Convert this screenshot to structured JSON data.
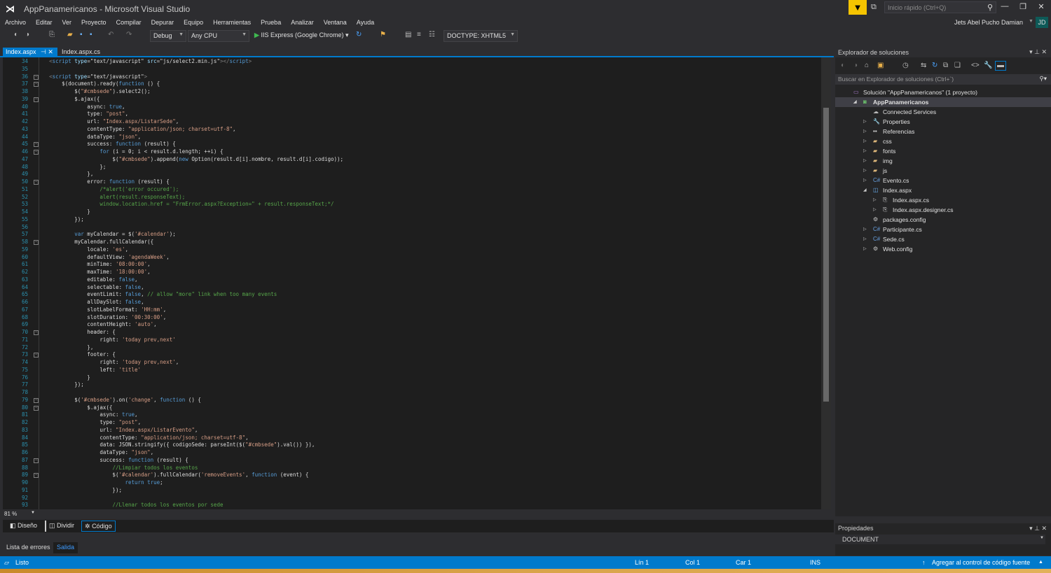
{
  "window": {
    "title": "AppPanamericanos - Microsoft Visual Studio",
    "quick_launch_placeholder": "Inicio rápido (Ctrl+Q)",
    "user": "Jets Abel Pucho Damian",
    "avatar_initials": "JD"
  },
  "menu": [
    "Archivo",
    "Editar",
    "Ver",
    "Proyecto",
    "Compilar",
    "Depurar",
    "Equipo",
    "Herramientas",
    "Prueba",
    "Analizar",
    "Ventana",
    "Ayuda"
  ],
  "toolbar": {
    "config": "Debug",
    "platform": "Any CPU",
    "run_target": "IIS Express (Google Chrome)",
    "doctype": "DOCTYPE: XHTML5"
  },
  "tabs": [
    {
      "label": "Index.aspx",
      "active": true
    },
    {
      "label": "Index.aspx.cs",
      "active": false
    }
  ],
  "editor": {
    "zoom": "81 %",
    "fold_lines": [
      36,
      37,
      39,
      45,
      46,
      50,
      58,
      70,
      73,
      79,
      80,
      87,
      89
    ],
    "lines": [
      {
        "n": 34,
        "code": [
          [
            "t",
            "        "
          ],
          [
            "g",
            "<"
          ],
          [
            "k",
            "script"
          ],
          [
            "a",
            " type"
          ],
          [
            "t",
            "=\"text/javascript\""
          ],
          [
            "a",
            " src"
          ],
          [
            "t",
            "=\"js/select2.min.js\""
          ],
          [
            "g",
            "></"
          ],
          [
            "k",
            "script"
          ],
          [
            "g",
            ">"
          ]
        ]
      },
      {
        "n": 35,
        "code": []
      },
      {
        "n": 36,
        "code": [
          [
            "t",
            "        "
          ],
          [
            "g",
            "<"
          ],
          [
            "k",
            "script"
          ],
          [
            "a",
            " type"
          ],
          [
            "t",
            "=\"text/javascript\""
          ],
          [
            "g",
            ">"
          ]
        ]
      },
      {
        "n": 37,
        "code": [
          [
            "t",
            "            $(document).ready("
          ],
          [
            "k",
            "function"
          ],
          [
            "t",
            " () {"
          ]
        ]
      },
      {
        "n": 38,
        "code": [
          [
            "t",
            "                $("
          ],
          [
            "s",
            "\"#cmbsede\""
          ],
          [
            "t",
            ").select2();"
          ]
        ]
      },
      {
        "n": 39,
        "code": [
          [
            "t",
            "                $.ajax({"
          ]
        ]
      },
      {
        "n": 40,
        "code": [
          [
            "t",
            "                    async: "
          ],
          [
            "k",
            "true"
          ],
          [
            "t",
            ","
          ]
        ]
      },
      {
        "n": 41,
        "code": [
          [
            "t",
            "                    type: "
          ],
          [
            "s",
            "\"post\""
          ],
          [
            "t",
            ","
          ]
        ]
      },
      {
        "n": 42,
        "code": [
          [
            "t",
            "                    url: "
          ],
          [
            "s",
            "\"Index.aspx/ListarSede\""
          ],
          [
            "t",
            ","
          ]
        ]
      },
      {
        "n": 43,
        "code": [
          [
            "t",
            "                    contentType: "
          ],
          [
            "s",
            "\"application/json; charset=utf-8\""
          ],
          [
            "t",
            ","
          ]
        ]
      },
      {
        "n": 44,
        "code": [
          [
            "t",
            "                    dataType: "
          ],
          [
            "s",
            "\"json\""
          ],
          [
            "t",
            ","
          ]
        ]
      },
      {
        "n": 45,
        "code": [
          [
            "t",
            "                    success: "
          ],
          [
            "k",
            "function"
          ],
          [
            "t",
            " (result) {"
          ]
        ]
      },
      {
        "n": 46,
        "code": [
          [
            "t",
            "                        "
          ],
          [
            "k",
            "for"
          ],
          [
            "t",
            " (i = 0; i < result.d.length; ++i) {"
          ]
        ]
      },
      {
        "n": 47,
        "code": [
          [
            "t",
            "                            $("
          ],
          [
            "s",
            "\"#cmbsede\""
          ],
          [
            "t",
            ").append("
          ],
          [
            "k",
            "new"
          ],
          [
            "t",
            " Option(result.d[i].nombre, result.d[i].codigo));"
          ]
        ]
      },
      {
        "n": 48,
        "code": [
          [
            "t",
            "                        };"
          ]
        ]
      },
      {
        "n": 49,
        "code": [
          [
            "t",
            "                    },"
          ]
        ]
      },
      {
        "n": 50,
        "code": [
          [
            "t",
            "                    error: "
          ],
          [
            "k",
            "function"
          ],
          [
            "t",
            " (result) {"
          ]
        ]
      },
      {
        "n": 51,
        "code": [
          [
            "t",
            "                        "
          ],
          [
            "c",
            "/*alert('error occured');"
          ]
        ]
      },
      {
        "n": 52,
        "code": [
          [
            "t",
            "                        "
          ],
          [
            "c",
            "alert(result.responseText);"
          ]
        ]
      },
      {
        "n": 53,
        "code": [
          [
            "t",
            "                        "
          ],
          [
            "c",
            "window.location.href = \"FrmError.aspx?Exception=\" + result.responseText;*/"
          ]
        ]
      },
      {
        "n": 54,
        "code": [
          [
            "t",
            "                    }"
          ]
        ]
      },
      {
        "n": 55,
        "code": [
          [
            "t",
            "                });"
          ]
        ]
      },
      {
        "n": 56,
        "code": []
      },
      {
        "n": 57,
        "code": [
          [
            "t",
            "                "
          ],
          [
            "k",
            "var"
          ],
          [
            "t",
            " myCalendar = $("
          ],
          [
            "s",
            "'#calendar'"
          ],
          [
            "t",
            ");"
          ]
        ]
      },
      {
        "n": 58,
        "code": [
          [
            "t",
            "                myCalendar.fullCalendar({"
          ]
        ]
      },
      {
        "n": 59,
        "code": [
          [
            "t",
            "                    locale: "
          ],
          [
            "s",
            "'es'"
          ],
          [
            "t",
            ","
          ]
        ]
      },
      {
        "n": 60,
        "code": [
          [
            "t",
            "                    defaultView: "
          ],
          [
            "s",
            "'agendaWeek'"
          ],
          [
            "t",
            ","
          ]
        ]
      },
      {
        "n": 61,
        "code": [
          [
            "t",
            "                    minTime: "
          ],
          [
            "s",
            "'08:00:00'"
          ],
          [
            "t",
            ","
          ]
        ]
      },
      {
        "n": 62,
        "code": [
          [
            "t",
            "                    maxTime: "
          ],
          [
            "s",
            "'18:00:00'"
          ],
          [
            "t",
            ","
          ]
        ]
      },
      {
        "n": 63,
        "code": [
          [
            "t",
            "                    editable: "
          ],
          [
            "k",
            "false"
          ],
          [
            "t",
            ","
          ]
        ]
      },
      {
        "n": 64,
        "code": [
          [
            "t",
            "                    selectable: "
          ],
          [
            "k",
            "false"
          ],
          [
            "t",
            ","
          ]
        ]
      },
      {
        "n": 65,
        "code": [
          [
            "t",
            "                    eventLimit: "
          ],
          [
            "k",
            "false"
          ],
          [
            "t",
            ", "
          ],
          [
            "c",
            "// allow \"more\" link when too many events"
          ]
        ]
      },
      {
        "n": 66,
        "code": [
          [
            "t",
            "                    allDaySlot: "
          ],
          [
            "k",
            "false"
          ],
          [
            "t",
            ","
          ]
        ]
      },
      {
        "n": 67,
        "code": [
          [
            "t",
            "                    slotLabelFormat: "
          ],
          [
            "s",
            "'HH:mm'"
          ],
          [
            "t",
            ","
          ]
        ]
      },
      {
        "n": 68,
        "code": [
          [
            "t",
            "                    slotDuration: "
          ],
          [
            "s",
            "'00:30:00'"
          ],
          [
            "t",
            ","
          ]
        ]
      },
      {
        "n": 69,
        "code": [
          [
            "t",
            "                    contentHeight: "
          ],
          [
            "s",
            "'auto'"
          ],
          [
            "t",
            ","
          ]
        ]
      },
      {
        "n": 70,
        "code": [
          [
            "t",
            "                    header: {"
          ]
        ]
      },
      {
        "n": 71,
        "code": [
          [
            "t",
            "                        right: "
          ],
          [
            "s",
            "'today prev,next'"
          ]
        ]
      },
      {
        "n": 72,
        "code": [
          [
            "t",
            "                    },"
          ]
        ]
      },
      {
        "n": 73,
        "code": [
          [
            "t",
            "                    footer: {"
          ]
        ]
      },
      {
        "n": 74,
        "code": [
          [
            "t",
            "                        right: "
          ],
          [
            "s",
            "'today prev,next'"
          ],
          [
            "t",
            ","
          ]
        ]
      },
      {
        "n": 75,
        "code": [
          [
            "t",
            "                        left: "
          ],
          [
            "s",
            "'title'"
          ]
        ]
      },
      {
        "n": 76,
        "code": [
          [
            "t",
            "                    }"
          ]
        ]
      },
      {
        "n": 77,
        "code": [
          [
            "t",
            "                });"
          ]
        ]
      },
      {
        "n": 78,
        "code": []
      },
      {
        "n": 79,
        "code": [
          [
            "t",
            "                $("
          ],
          [
            "s",
            "'#cmbsede'"
          ],
          [
            "t",
            ").on("
          ],
          [
            "s",
            "'change'"
          ],
          [
            "t",
            ", "
          ],
          [
            "k",
            "function"
          ],
          [
            "t",
            " () {"
          ]
        ]
      },
      {
        "n": 80,
        "code": [
          [
            "t",
            "                    $.ajax({"
          ]
        ]
      },
      {
        "n": 81,
        "code": [
          [
            "t",
            "                        async: "
          ],
          [
            "k",
            "true"
          ],
          [
            "t",
            ","
          ]
        ]
      },
      {
        "n": 82,
        "code": [
          [
            "t",
            "                        type: "
          ],
          [
            "s",
            "\"post\""
          ],
          [
            "t",
            ","
          ]
        ]
      },
      {
        "n": 83,
        "code": [
          [
            "t",
            "                        url: "
          ],
          [
            "s",
            "\"Index.aspx/ListarEvento\""
          ],
          [
            "t",
            ","
          ]
        ]
      },
      {
        "n": 84,
        "code": [
          [
            "t",
            "                        contentType: "
          ],
          [
            "s",
            "\"application/json; charset=utf-8\""
          ],
          [
            "t",
            ","
          ]
        ]
      },
      {
        "n": 85,
        "code": [
          [
            "t",
            "                        data: JSON.stringify({ codigoSede: parseInt($("
          ],
          [
            "s",
            "\"#cmbsede\""
          ],
          [
            "t",
            ").val()) }),"
          ]
        ]
      },
      {
        "n": 86,
        "code": [
          [
            "t",
            "                        dataType: "
          ],
          [
            "s",
            "\"json\""
          ],
          [
            "t",
            ","
          ]
        ]
      },
      {
        "n": 87,
        "code": [
          [
            "t",
            "                        success: "
          ],
          [
            "k",
            "function"
          ],
          [
            "t",
            " (result) {"
          ]
        ]
      },
      {
        "n": 88,
        "code": [
          [
            "t",
            "                            "
          ],
          [
            "c",
            "//Limpiar todos los eventos"
          ]
        ]
      },
      {
        "n": 89,
        "code": [
          [
            "t",
            "                            $("
          ],
          [
            "s",
            "'#calendar'"
          ],
          [
            "t",
            ").fullCalendar("
          ],
          [
            "s",
            "'removeEvents'"
          ],
          [
            "t",
            ", "
          ],
          [
            "k",
            "function"
          ],
          [
            "t",
            " (event) {"
          ]
        ]
      },
      {
        "n": 90,
        "code": [
          [
            "t",
            "                                "
          ],
          [
            "k",
            "return"
          ],
          [
            "t",
            " "
          ],
          [
            "k",
            "true"
          ],
          [
            "t",
            ";"
          ]
        ]
      },
      {
        "n": 91,
        "code": [
          [
            "t",
            "                            });"
          ]
        ]
      },
      {
        "n": 92,
        "code": []
      },
      {
        "n": 93,
        "code": [
          [
            "t",
            "                            "
          ],
          [
            "c",
            "//Llenar todos los eventos por sede"
          ]
        ]
      }
    ]
  },
  "view_tabs": [
    "Diseño",
    "Dividir",
    "Código"
  ],
  "bottom_tabs": [
    "Lista de errores",
    "Salida"
  ],
  "solution_explorer": {
    "title": "Explorador de soluciones",
    "search_placeholder": "Buscar en Explorador de soluciones (Ctrl+`)",
    "items": [
      {
        "label": "Solución \"AppPanamericanos\"  (1 proyecto)",
        "depth": 0,
        "icon": "solution-icon",
        "arrow": ""
      },
      {
        "label": "AppPanamericanos",
        "depth": 1,
        "icon": "web-project-icon",
        "arrow": "expanded",
        "bold": true
      },
      {
        "label": "Connected Services",
        "depth": 2,
        "icon": "connected-services-icon",
        "arrow": ""
      },
      {
        "label": "Properties",
        "depth": 2,
        "icon": "wrench-icon",
        "arrow": "collapsed"
      },
      {
        "label": "Referencias",
        "depth": 2,
        "icon": "references-icon",
        "arrow": "collapsed"
      },
      {
        "label": "css",
        "depth": 2,
        "icon": "folder-icon",
        "arrow": "collapsed"
      },
      {
        "label": "fonts",
        "depth": 2,
        "icon": "folder-icon",
        "arrow": "collapsed"
      },
      {
        "label": "img",
        "depth": 2,
        "icon": "folder-icon",
        "arrow": "collapsed"
      },
      {
        "label": "js",
        "depth": 2,
        "icon": "folder-icon",
        "arrow": "collapsed"
      },
      {
        "label": "Evento.cs",
        "depth": 2,
        "icon": "csharp-file-icon",
        "arrow": "collapsed"
      },
      {
        "label": "Index.aspx",
        "depth": 2,
        "icon": "aspx-file-icon",
        "arrow": "expanded"
      },
      {
        "label": "Index.aspx.cs",
        "depth": 3,
        "icon": "code-file-icon",
        "arrow": "collapsed"
      },
      {
        "label": "Index.aspx.designer.cs",
        "depth": 3,
        "icon": "code-file-icon",
        "arrow": "collapsed"
      },
      {
        "label": "packages.config",
        "depth": 2,
        "icon": "config-file-icon",
        "arrow": ""
      },
      {
        "label": "Participante.cs",
        "depth": 2,
        "icon": "csharp-file-icon",
        "arrow": "collapsed"
      },
      {
        "label": "Sede.cs",
        "depth": 2,
        "icon": "csharp-file-icon",
        "arrow": "collapsed"
      },
      {
        "label": "Web.config",
        "depth": 2,
        "icon": "config-file-icon",
        "arrow": "collapsed"
      }
    ]
  },
  "properties": {
    "title": "Propiedades",
    "object": "DOCUMENT"
  },
  "status": {
    "state": "Listo",
    "line": "Lín 1",
    "col": "Col 1",
    "char": "Car 1",
    "mode": "INS",
    "source_control": "Agregar al control de código fuente"
  },
  "colors": {
    "accent": "#007acc",
    "keyword": "#569cd6",
    "string": "#d69d85",
    "comment": "#57a64a",
    "line_number": "#2b91af",
    "editor_bg": "#1e1e1e"
  }
}
